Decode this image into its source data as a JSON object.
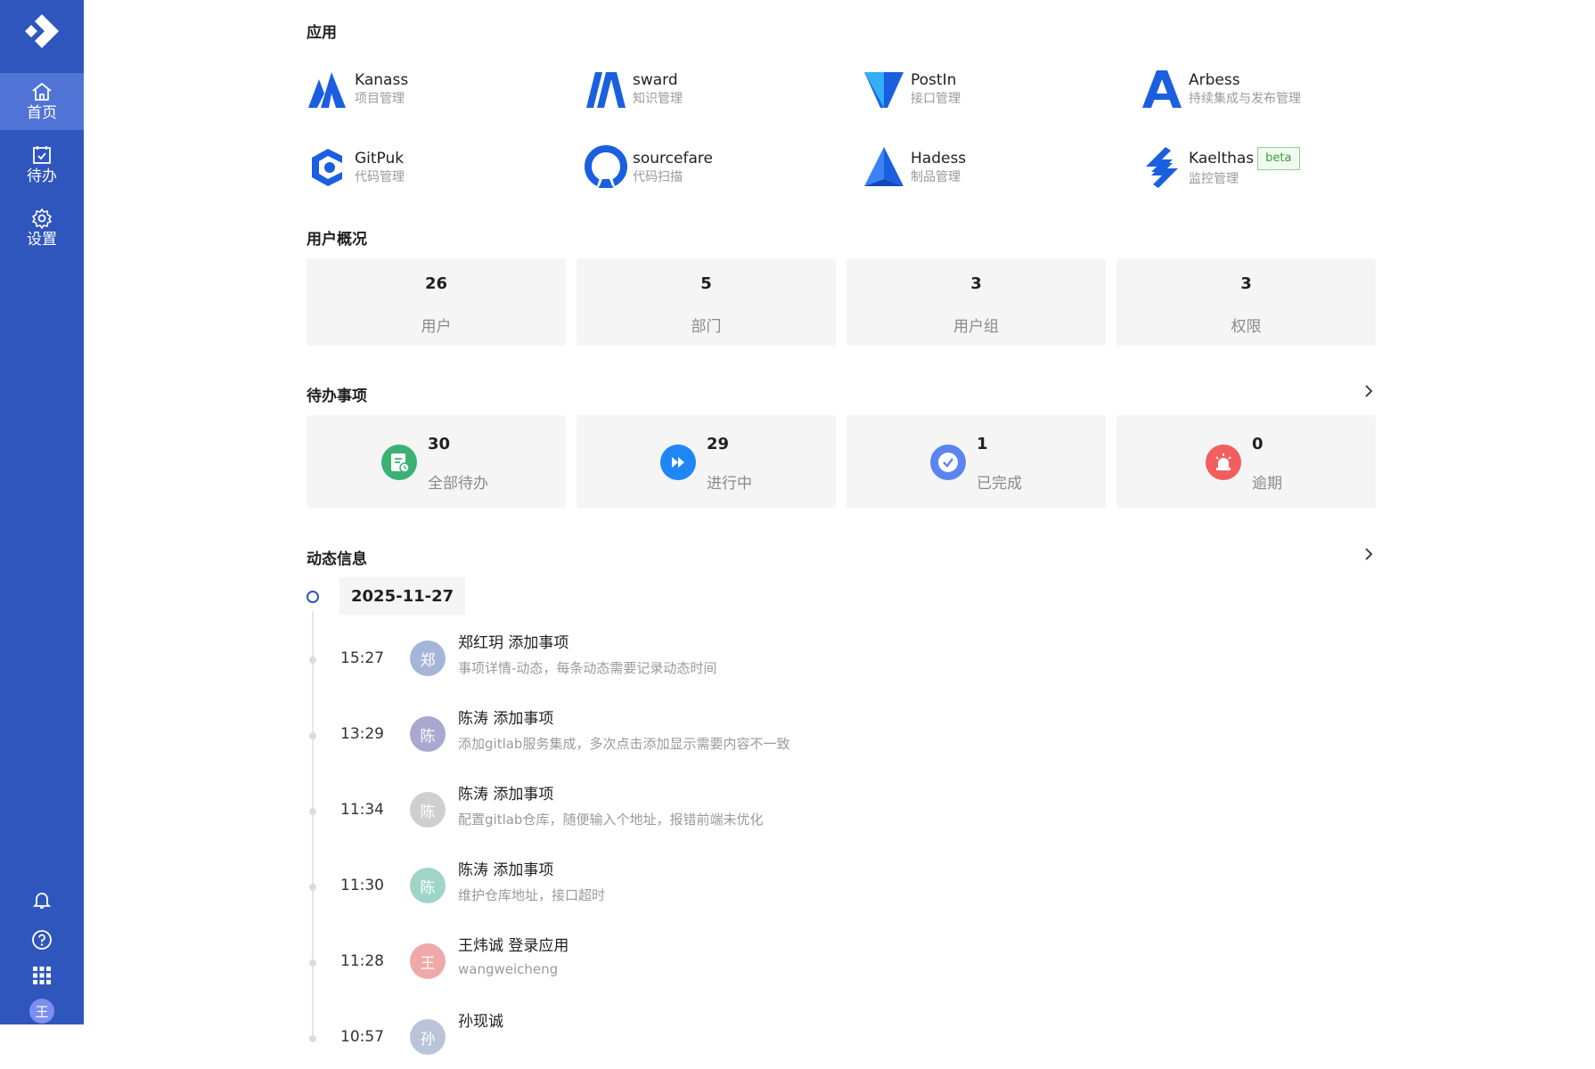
{
  "colors": {
    "sidebar": "#2f56bd",
    "active": "#4f74d6",
    "card": "#f5f5f5"
  },
  "sidebar": {
    "items": [
      {
        "label": "首页",
        "icon": "home-icon"
      },
      {
        "label": "待办",
        "icon": "calendar-check-icon"
      },
      {
        "label": "设置",
        "icon": "gear-icon"
      }
    ],
    "avatar": "王"
  },
  "apps": {
    "title": "应用",
    "items": [
      {
        "name": "Kanass",
        "desc": "项目管理"
      },
      {
        "name": "sward",
        "desc": "知识管理"
      },
      {
        "name": "PostIn",
        "desc": "接口管理"
      },
      {
        "name": "Arbess",
        "desc": "持续集成与发布管理"
      },
      {
        "name": "GitPuk",
        "desc": "代码管理"
      },
      {
        "name": "sourcefare",
        "desc": "代码扫描"
      },
      {
        "name": "Hadess",
        "desc": "制品管理"
      },
      {
        "name": "Kaelthas",
        "desc": "监控管理",
        "badge": "beta"
      }
    ]
  },
  "users": {
    "title": "用户概况",
    "stats": [
      {
        "value": "26",
        "label": "用户"
      },
      {
        "value": "5",
        "label": "部门"
      },
      {
        "value": "3",
        "label": "用户组"
      },
      {
        "value": "3",
        "label": "权限"
      }
    ]
  },
  "todos": {
    "title": "待办事项",
    "stats": [
      {
        "value": "30",
        "label": "全部待办",
        "color": "#3bb273"
      },
      {
        "value": "29",
        "label": "进行中",
        "color": "#1f87f5"
      },
      {
        "value": "1",
        "label": "已完成",
        "color": "#5b84f0"
      },
      {
        "value": "0",
        "label": "逾期",
        "color": "#f25e5e"
      }
    ]
  },
  "activity": {
    "title": "动态信息",
    "date": "2025-11-27",
    "items": [
      {
        "time": "15:27",
        "avatar": "郑",
        "avatar_color": "#a5b5d8",
        "title": "郑红玥 添加事项",
        "desc": "事项详情-动态，每条动态需要记录动态时间"
      },
      {
        "time": "13:29",
        "avatar": "陈",
        "avatar_color": "#a9a8d0",
        "title": "陈涛 添加事项",
        "desc": "添加gitlab服务集成，多次点击添加显示需要内容不一致"
      },
      {
        "time": "11:34",
        "avatar": "陈",
        "avatar_color": "#cfcfcf",
        "title": "陈涛 添加事项",
        "desc": "配置gitlab仓库，随便输入个地址，报错前端未优化"
      },
      {
        "time": "11:30",
        "avatar": "陈",
        "avatar_color": "#9fd5c8",
        "title": "陈涛 添加事项",
        "desc": "维护仓库地址，接口超时"
      },
      {
        "time": "11:28",
        "avatar": "王",
        "avatar_color": "#f0a9a9",
        "title": "王炜诚 登录应用",
        "desc": "wangweicheng"
      },
      {
        "time": "10:57",
        "avatar": "孙",
        "avatar_color": "#b9c4d8",
        "title": "孙现诚",
        "desc": ""
      }
    ]
  }
}
